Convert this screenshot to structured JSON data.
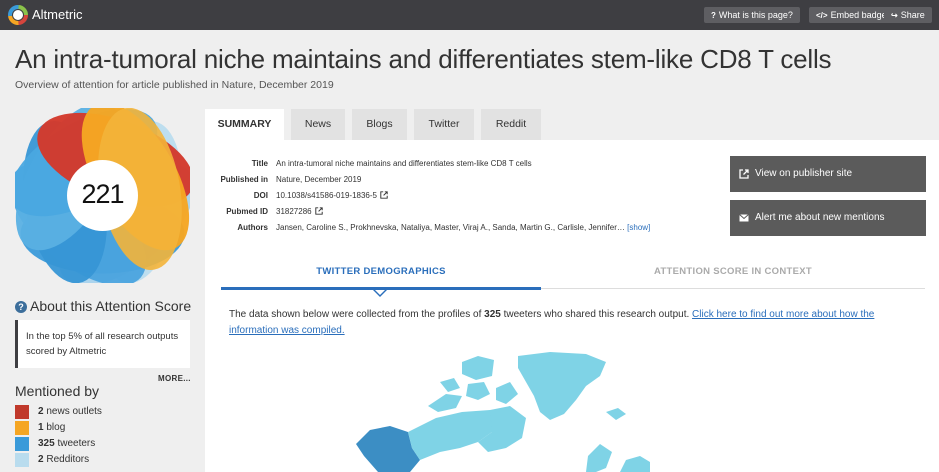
{
  "app": {
    "name": "Altmetric",
    "buttons": [
      {
        "label": "What is this page?",
        "icon": "question-icon"
      },
      {
        "label": "Embed badge",
        "icon": "code-icon"
      },
      {
        "label": "Share",
        "icon": "share-icon"
      }
    ]
  },
  "article": {
    "title": "An intra-tumoral niche maintains and differentiates stem-like CD8 T cells",
    "subtitle": "Overview of attention for article published in Nature, December 2019"
  },
  "score": {
    "value": "221",
    "about_heading": "About this Attention Score",
    "summary": "In the top 5% of all research outputs scored by Altmetric",
    "more_label": "MORE..."
  },
  "mentions": {
    "heading": "Mentioned by",
    "items": [
      {
        "count": "2",
        "label": "news outlets",
        "color": "#c0392b"
      },
      {
        "count": "1",
        "label": "blog",
        "color": "#f5a623"
      },
      {
        "count": "325",
        "label": "tweeters",
        "color": "#3a9ad9"
      },
      {
        "count": "2",
        "label": "Redditors",
        "color": "#b9dcee"
      }
    ]
  },
  "tabs": [
    "SUMMARY",
    "News",
    "Blogs",
    "Twitter",
    "Reddit"
  ],
  "metadata": {
    "rows": [
      {
        "label": "Title",
        "value": "An intra-tumoral niche maintains and differentiates stem-like CD8 T cells"
      },
      {
        "label": "Published in",
        "value": "Nature, December 2019"
      },
      {
        "label": "DOI",
        "value": "10.1038/s41586-019-1836-5"
      },
      {
        "label": "Pubmed ID",
        "value": "31827286"
      },
      {
        "label": "Authors",
        "value": "Jansen, Caroline S., Prokhnevska, Nataliya, Master, Viraj A., Sanda, Martin G., Carlisle, Jennifer…"
      }
    ],
    "show_label": "[show]"
  },
  "actions": {
    "publisher": "View on publisher site",
    "alert": "Alert me about new mentions"
  },
  "demographics": {
    "tab_active": "TWITTER DEMOGRAPHICS",
    "tab_inactive": "ATTENTION SCORE IN CONTEXT",
    "text_before": "The data shown below were collected from the profiles of ",
    "count": "325",
    "text_after": " tweeters who shared this research output. ",
    "link": "Click here to find out more about how the information was compiled."
  },
  "colors": {
    "topbar": "#3e3e42",
    "accent": "#2a6ebb",
    "news": "#c0392b",
    "blog": "#f5a623",
    "twitter": "#3a9ad9",
    "reddit": "#b9dcee"
  }
}
